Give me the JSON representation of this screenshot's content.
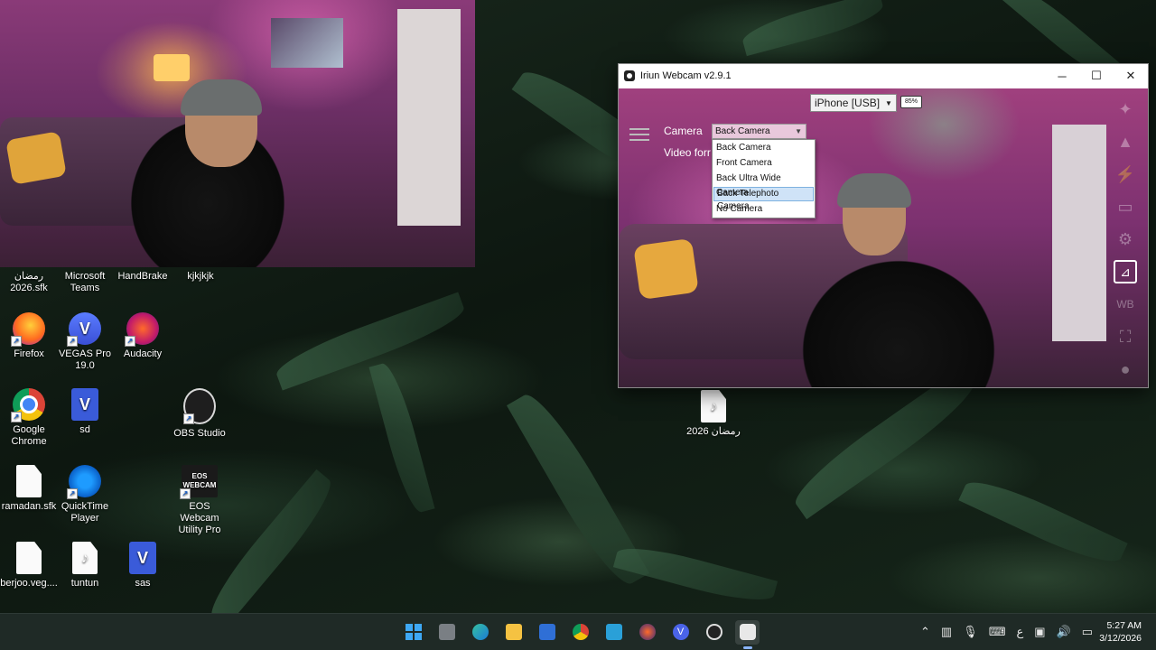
{
  "desktop": {
    "icons": [
      {
        "label": "رمضان 2026.sfk"
      },
      {
        "label": "Microsoft Teams"
      },
      {
        "label": "HandBrake"
      },
      {
        "label": "kjkjkjk"
      },
      {
        "label": "Firefox"
      },
      {
        "label": "VEGAS Pro 19.0"
      },
      {
        "label": "Audacity"
      },
      {
        "label": "Google Chrome"
      },
      {
        "label": "sd",
        "badge": "V"
      },
      {
        "label": "OBS Studio"
      },
      {
        "label": "ramadan.sfk"
      },
      {
        "label": "QuickTime Player"
      },
      {
        "label": "EOS Webcam Utility Pro",
        "badge": "EOS WEBCAM"
      },
      {
        "label": "berjoo.veg...."
      },
      {
        "label": "tuntun",
        "badge": "WAV"
      },
      {
        "label": "sas",
        "badge": "V"
      },
      {
        "label": "رمضان 2026",
        "badge": "WAV"
      }
    ],
    "vegas_glyph": "V"
  },
  "iriun": {
    "title": "Iriun Webcam v2.9.1",
    "device": "iPhone [USB]",
    "battery": "85%",
    "camera_label": "Camera",
    "video_format_label": "Video forr",
    "camera_selected": "Back Camera",
    "camera_options": [
      "Back Camera",
      "Front Camera",
      "Back Ultra Wide Camera",
      "Back Telephoto Camera",
      "No Camera"
    ],
    "highlighted_option": "Back Telephoto Camera",
    "wb_label": "WB"
  },
  "taskbar": {
    "tray_lang": "ع",
    "time": "5:27 AM",
    "date": "3/12/2026"
  },
  "colors": {
    "taskbar_bg": "#1f2a26",
    "accent": "#3ea8f5",
    "dropdown_highlight": "#cfe3f7"
  }
}
